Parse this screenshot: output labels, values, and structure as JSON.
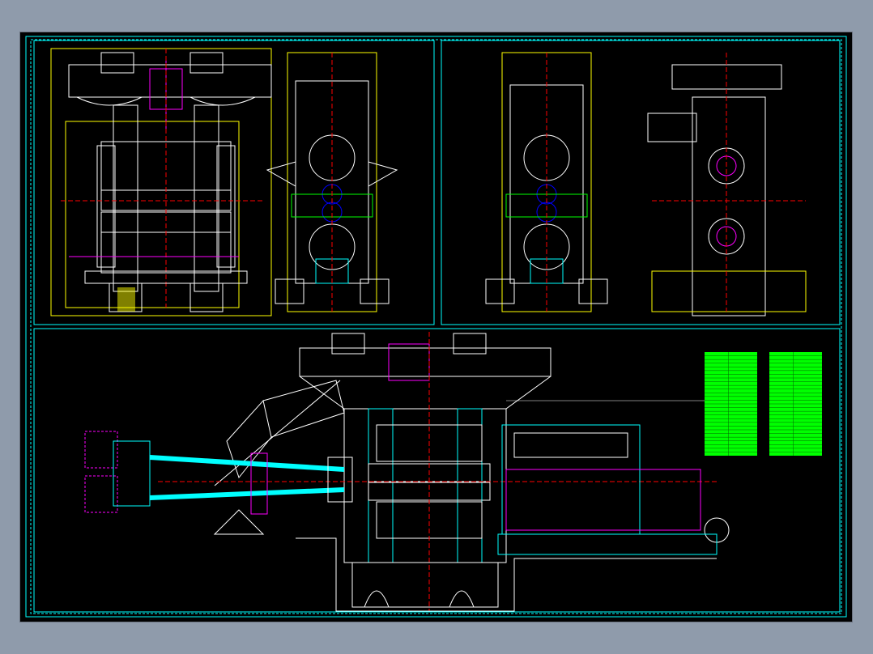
{
  "drawing": {
    "type": "cad-rolling-mill-assembly",
    "background": "#000000",
    "page_background": "#8f9bab",
    "line_colors": {
      "frame": "#00ffff",
      "outline": "#ffffff",
      "dimension": "#ffff00",
      "hydraulic": "#ff00ff",
      "centerline": "#ff0000",
      "gear": "#00ff00",
      "drive": "#0000ff"
    },
    "panels": [
      {
        "id": "top-left",
        "title": ""
      },
      {
        "id": "top-right",
        "title": ""
      },
      {
        "id": "bottom",
        "title": ""
      }
    ],
    "tables": [
      {
        "id": "parts-table-1",
        "color": "#00ff00",
        "rows": 28
      },
      {
        "id": "parts-table-2",
        "color": "#00ff00",
        "rows": 28
      }
    ]
  }
}
